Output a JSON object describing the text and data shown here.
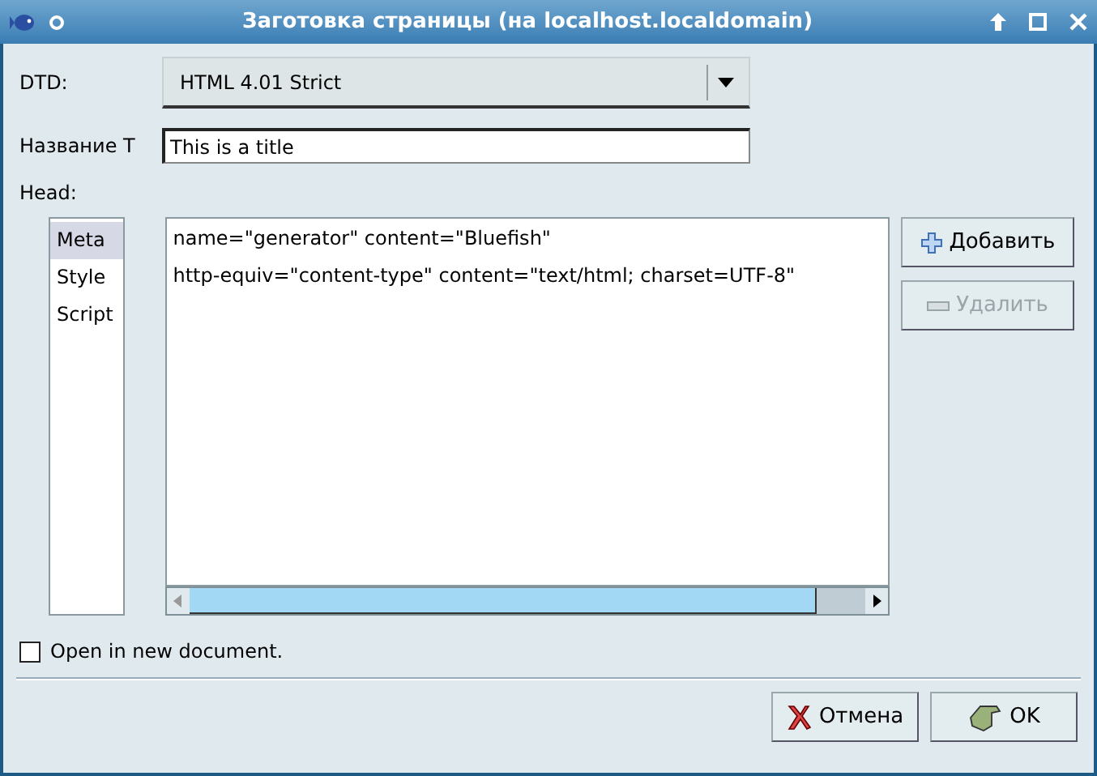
{
  "window": {
    "title": "Заготовка страницы (на localhost.localdomain)"
  },
  "dtd": {
    "label": "DTD:",
    "value": "HTML 4.01 Strict"
  },
  "title_field": {
    "label": "Название Т",
    "value": "This is a title"
  },
  "head": {
    "label": "Head:"
  },
  "categories": [
    {
      "label": "Meta",
      "selected": true
    },
    {
      "label": "Style",
      "selected": false
    },
    {
      "label": "Script",
      "selected": false
    }
  ],
  "lines": [
    "name=\"generator\" content=\"Bluefish\"",
    "http-equiv=\"content-type\" content=\"text/html; charset=UTF-8\""
  ],
  "side_buttons": [
    {
      "kind": "add",
      "label": "Добавить",
      "disabled": false
    },
    {
      "kind": "remove",
      "label": "Удалить",
      "disabled": true
    }
  ],
  "new_document": {
    "label": "Open in new document.",
    "checked": false
  },
  "buttons": [
    {
      "kind": "cancel",
      "label": "Отмена"
    },
    {
      "kind": "ok",
      "label": "OK"
    }
  ]
}
